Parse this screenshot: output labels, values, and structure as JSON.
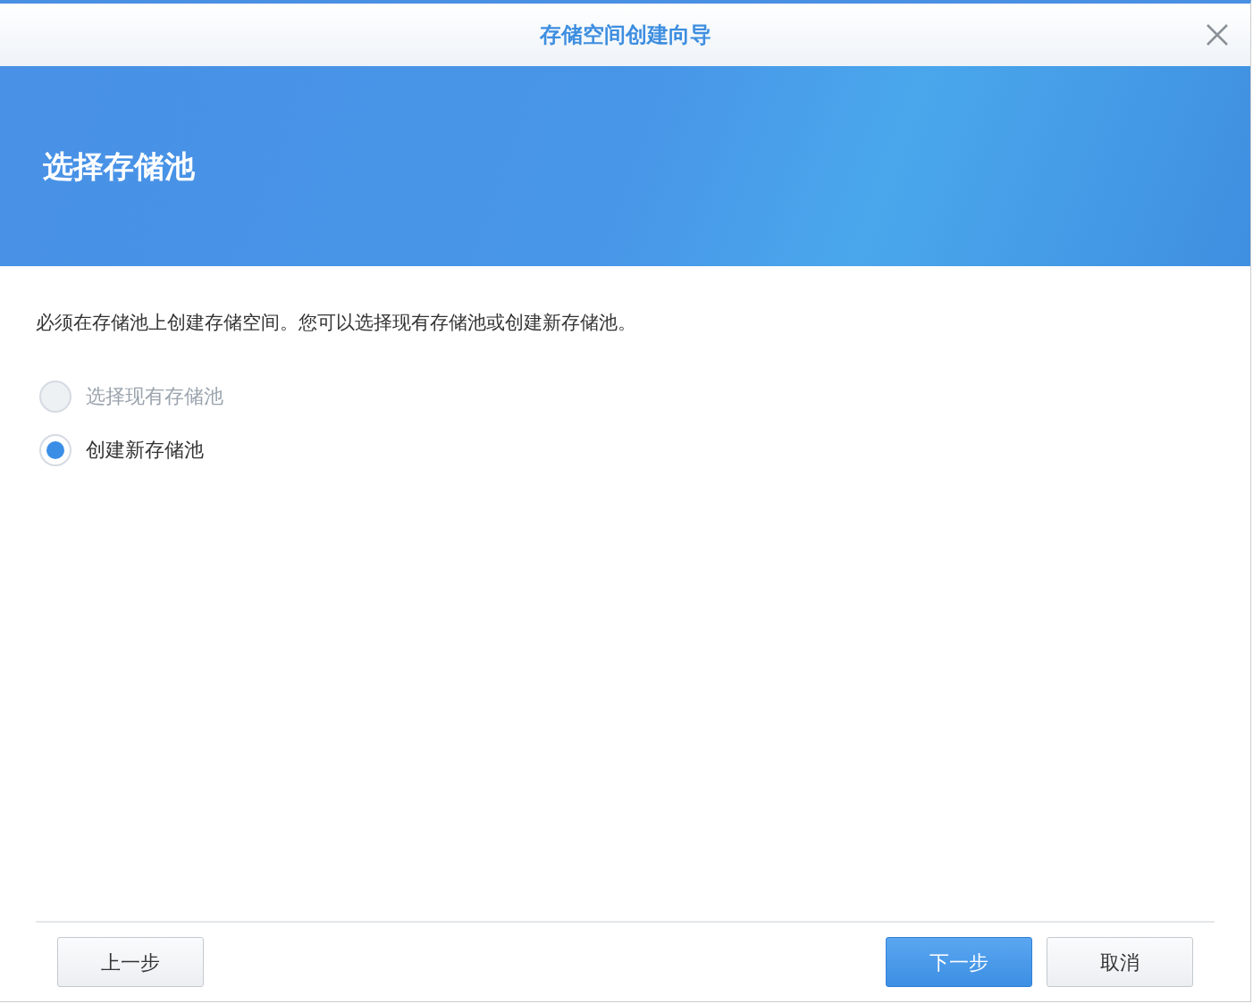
{
  "window": {
    "title": "存储空间创建向导"
  },
  "header": {
    "title": "选择存储池"
  },
  "description": "必须在存储池上创建存储空间。您可以选择现有存储池或创建新存储池。",
  "options": [
    {
      "label": "选择现有存储池",
      "selected": false,
      "disabled": true
    },
    {
      "label": "创建新存储池",
      "selected": true,
      "disabled": false
    }
  ],
  "footer": {
    "left_buttons": [
      {
        "label": "上一步",
        "kind": "secondary"
      }
    ],
    "right_buttons": [
      {
        "label": "下一步",
        "kind": "primary"
      },
      {
        "label": "取消",
        "kind": "secondary"
      }
    ]
  }
}
